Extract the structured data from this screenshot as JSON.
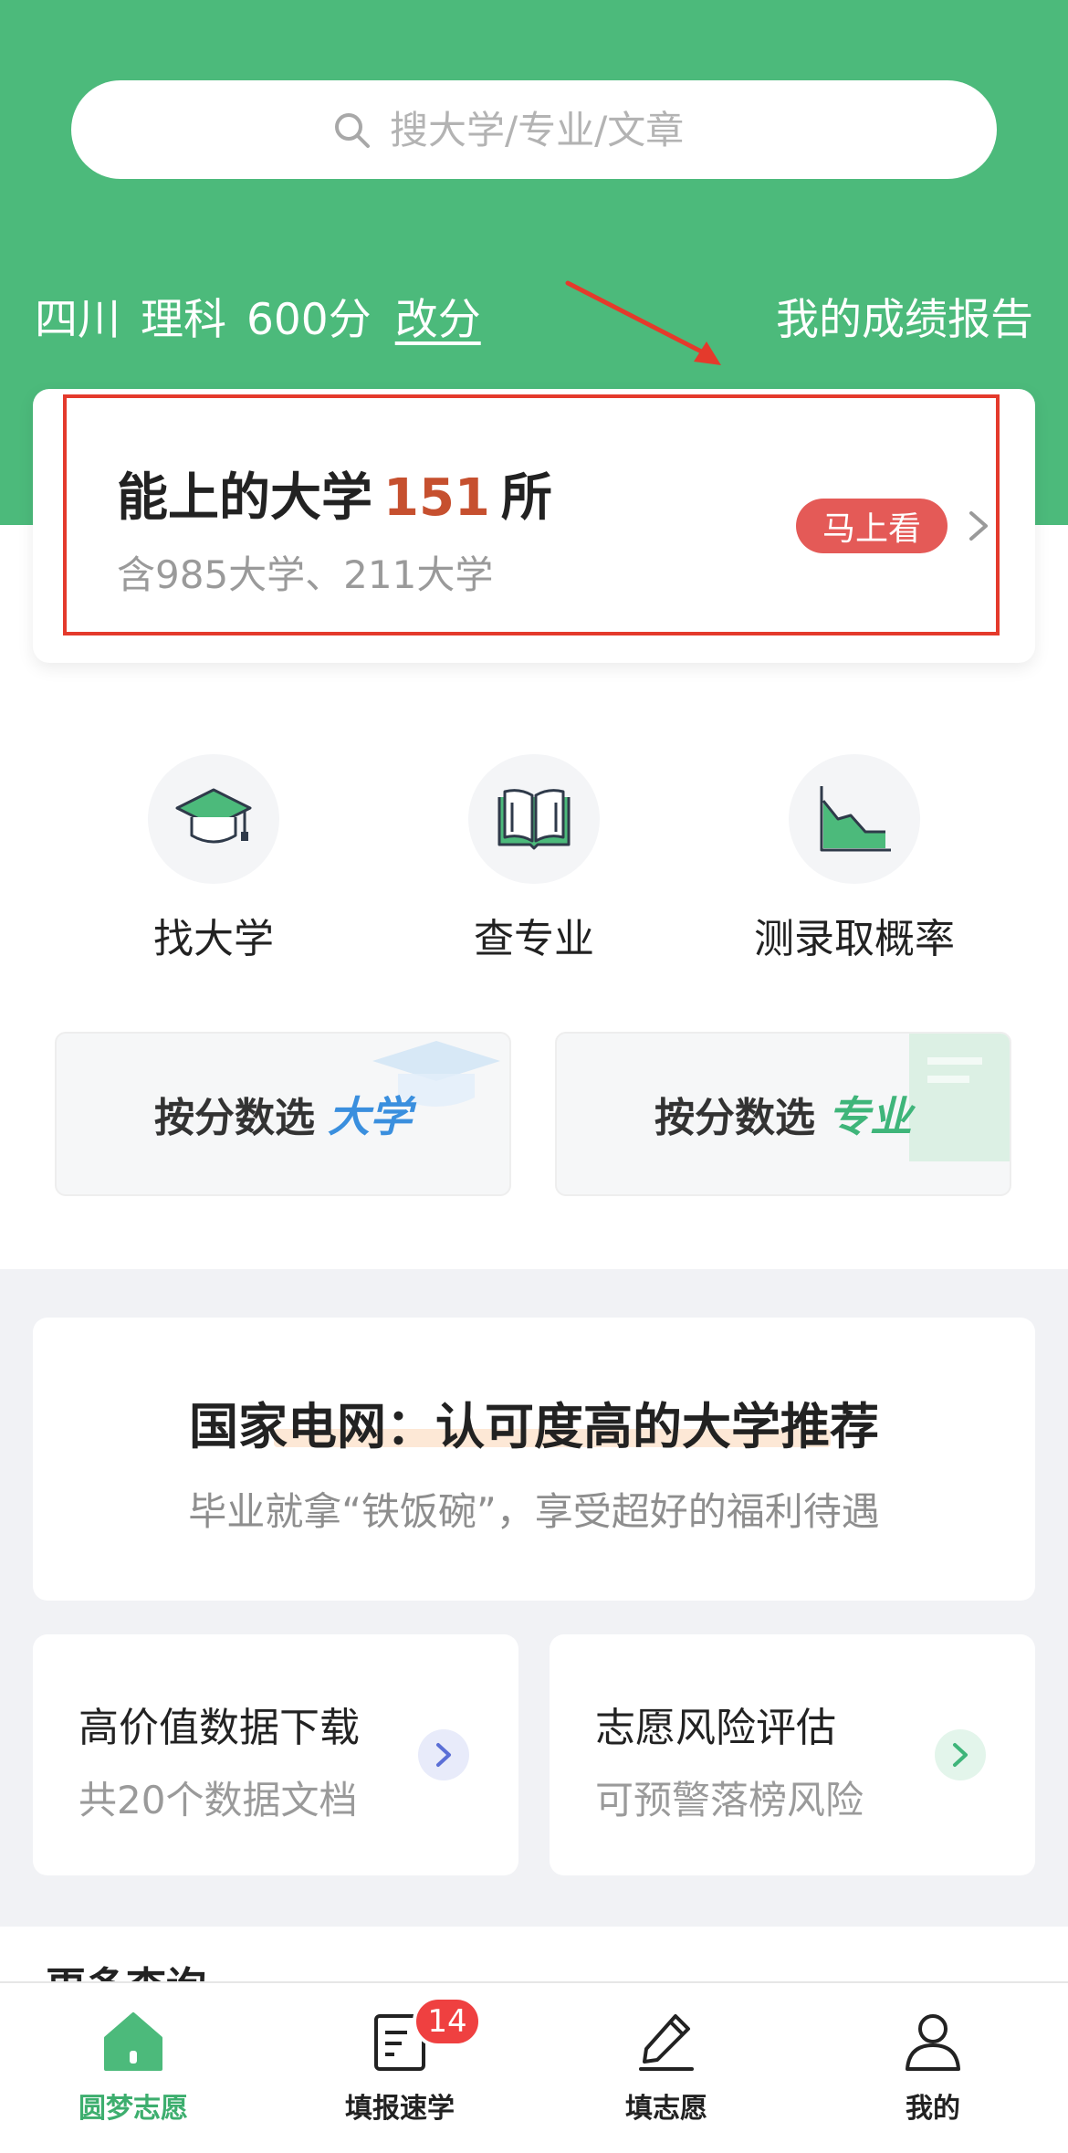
{
  "search": {
    "placeholder": "搜大学/专业/文章"
  },
  "score": {
    "province": "四川",
    "subject": "理科",
    "points": "600分",
    "change_label": "改分",
    "report_label": "我的成绩报告"
  },
  "uni_card": {
    "title_prefix": "能上的大学",
    "count": "151",
    "title_suffix": "所",
    "subtitle": "含985大学、211大学",
    "button_label": "马上看"
  },
  "tools": [
    {
      "label": "找大学",
      "icon": "graduation-cap-icon"
    },
    {
      "label": "查专业",
      "icon": "open-book-icon"
    },
    {
      "label": "测录取概率",
      "icon": "area-chart-icon"
    }
  ],
  "filters": [
    {
      "text": "按分数选",
      "accent": "大学",
      "accent_color": "#3a8fde"
    },
    {
      "text": "按分数选",
      "accent": "专业",
      "accent_color": "#3fb57a"
    }
  ],
  "promo": {
    "title": "国家电网：认可度高的大学推荐",
    "subtitle": "毕业就拿“铁饭碗”，享受超好的福利待遇"
  },
  "info_cards": [
    {
      "title": "高价值数据下载",
      "subtitle": "共20个数据文档",
      "arrow_color": "#5b6fd6",
      "arrow_bg": "#e8ebfa"
    },
    {
      "title": "志愿风险评估",
      "subtitle": "可预警落榜风险",
      "arrow_color": "#3fb57a",
      "arrow_bg": "#e3f5eb"
    }
  ],
  "more_query": "更多查询",
  "tabs": [
    {
      "label": "圆梦志愿",
      "icon": "home-icon",
      "active": true
    },
    {
      "label": "填报速学",
      "icon": "notepad-icon",
      "badge": "14"
    },
    {
      "label": "填志愿",
      "icon": "pen-icon"
    },
    {
      "label": "我的",
      "icon": "user-icon"
    }
  ],
  "colors": {
    "header_green": "#4cba7b",
    "accent_red": "#e45a57",
    "count_orange": "#c6502f",
    "annotation_red": "#e43a2c"
  }
}
